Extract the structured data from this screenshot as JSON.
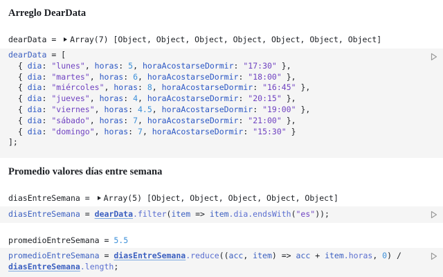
{
  "section1": {
    "title": "Arreglo DearData",
    "output": {
      "var": "dearData",
      "eq": " = ",
      "summary": "Array(7) [Object, Object, Object, Object, Object, Object, Object]"
    },
    "code": {
      "head": "dearData",
      "open": " = [",
      "rows": [
        {
          "dia": "\"lunes\"",
          "horas": "5",
          "hora": "\"17:30\"",
          "end": " },"
        },
        {
          "dia": "\"martes\"",
          "horas": "6",
          "hora": "\"18:00\"",
          "end": " },"
        },
        {
          "dia": "\"miércoles\"",
          "horas": "8",
          "hora": "\"16:45\"",
          "end": " },"
        },
        {
          "dia": "\"jueves\"",
          "horas": "4",
          "hora": "\"20:15\"",
          "end": " },"
        },
        {
          "dia": "\"viernes\"",
          "horas": "4.5",
          "hora": "\"19:00\"",
          "end": " },"
        },
        {
          "dia": "\"sábado\"",
          "horas": "7",
          "hora": "\"21:00\"",
          "end": " },"
        },
        {
          "dia": "\"domingo\"",
          "horas": "7",
          "hora": "\"15:30\"",
          "end": " }"
        }
      ],
      "keys": {
        "dia": "dia",
        "horas": "horas",
        "hora": "horaAcostarseDormir"
      },
      "close": "];"
    }
  },
  "section2": {
    "title": "Promedio valores días entre semana",
    "output1": {
      "var": "diasEntreSemana",
      "eq": " = ",
      "summary": "Array(5) [Object, Object, Object, Object, Object]"
    },
    "code1": {
      "var": "diasEntreSemana",
      "eq": " = ",
      "ref": "dearData",
      "method": ".filter",
      "lp": "(",
      "param": "item",
      "arrow": " => ",
      "obj": "item",
      "prop": ".dia",
      "call": ".endsWith",
      "lp2": "(",
      "arg": "\"es\"",
      "rp": "));"
    },
    "output2": {
      "var": "promedioEntreSemana",
      "eq": " = ",
      "value": "5.5"
    },
    "code2": {
      "var": "promedioEntreSemana",
      "eq": " = ",
      "ref": "diasEntreSemana",
      "method": ".reduce",
      "lp": "((",
      "acc": "acc",
      "comma": ", ",
      "item": "item",
      "arrow": ") => ",
      "acc2": "acc",
      "plus": " + ",
      "obj": "item",
      "prop": ".horas",
      "comma2": ", ",
      "zero": "0",
      "div": ") /",
      "ref2": "diasEntreSemana",
      "len": ".length",
      "semi": ";"
    }
  },
  "icons": {
    "run": "play-icon",
    "expand": "caret-right-icon"
  }
}
